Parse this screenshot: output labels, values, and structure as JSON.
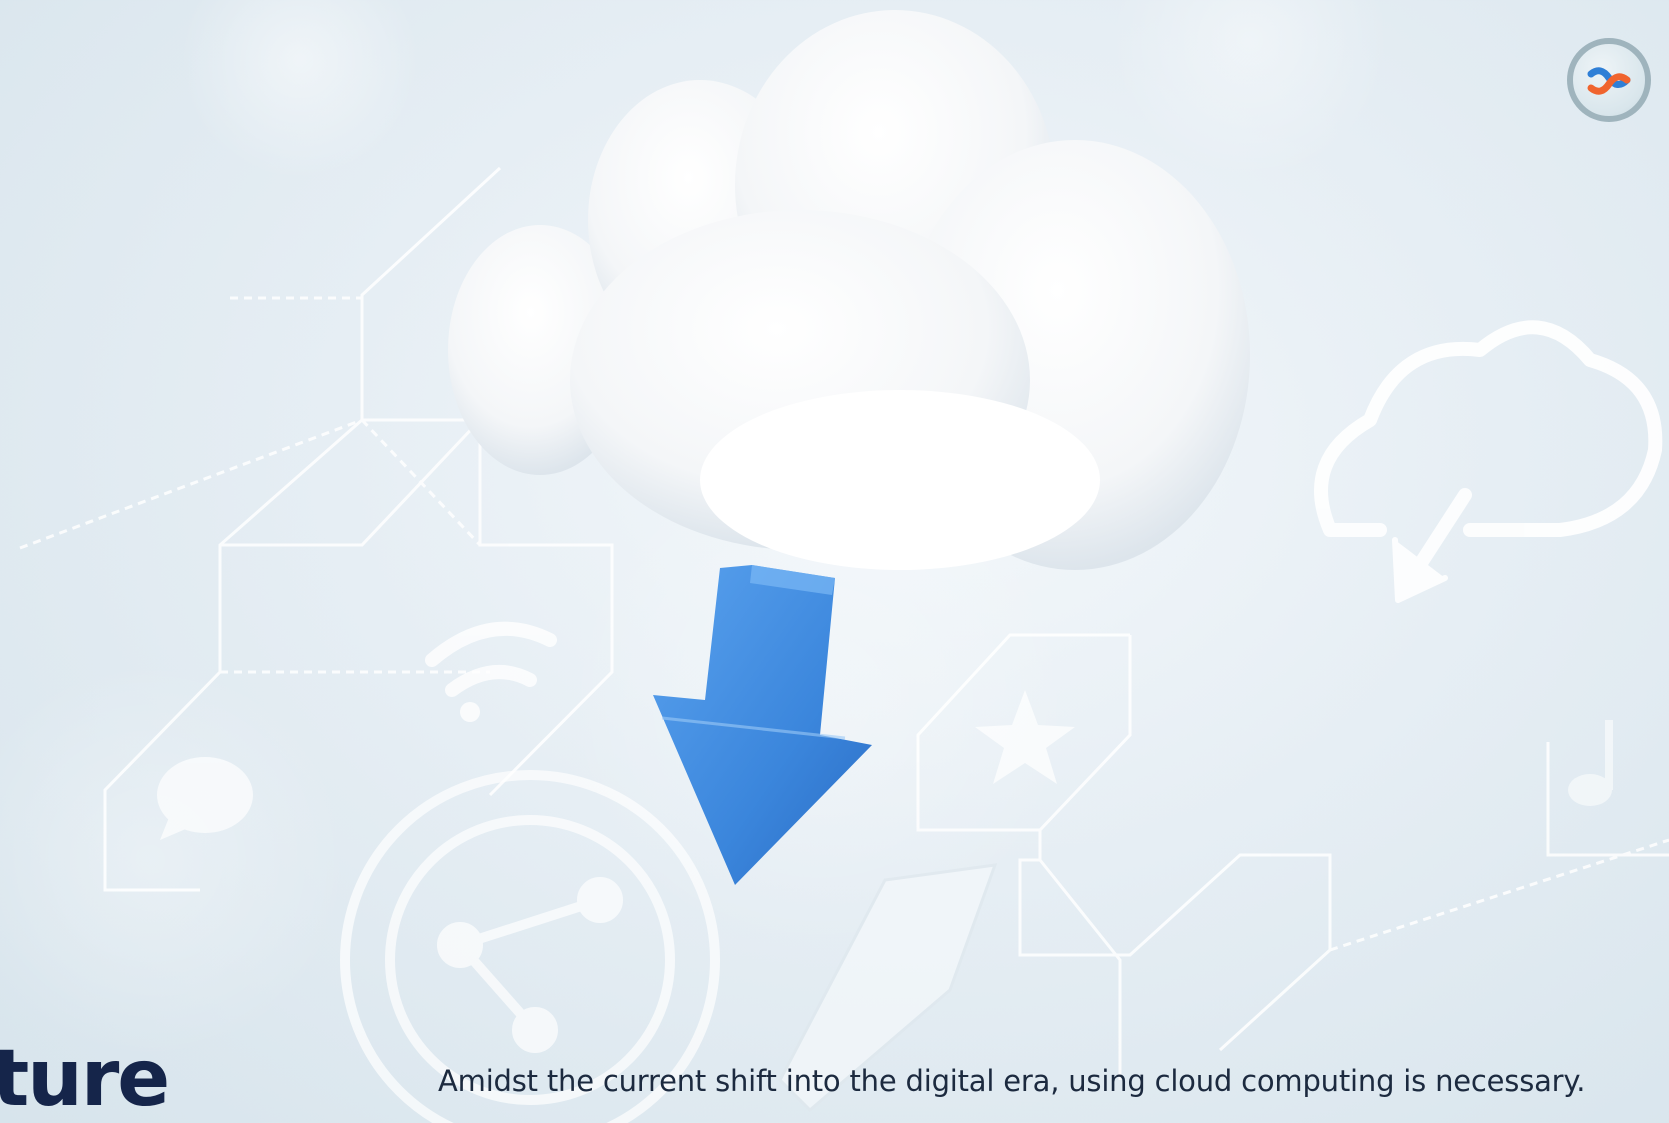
{
  "slide": {
    "heading_fragment": "ture",
    "caption": "Amidst the current shift into the digital era, using cloud computing is necessary."
  },
  "logo": {
    "icon": "brand-logo-icon",
    "colors": {
      "blue": "#2f7fd6",
      "orange": "#f0642e"
    }
  },
  "illustration": {
    "main": "cloud-download-illustration",
    "colors": {
      "cloud": "#ffffff",
      "arrow": "#3b86dc",
      "background": "#e6eef4",
      "lines": "#ffffff"
    }
  }
}
